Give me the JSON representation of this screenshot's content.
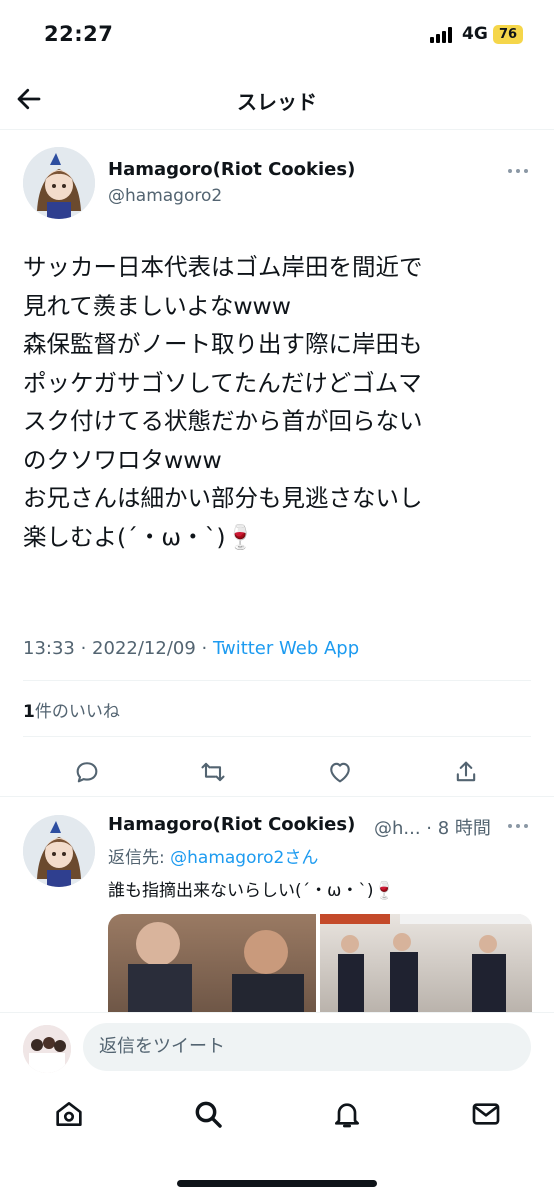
{
  "status_bar": {
    "time": "22:27",
    "network": "4G",
    "battery": "76"
  },
  "header": {
    "title": "スレッド"
  },
  "main_tweet": {
    "author_name": "Hamagoro(Riot Cookies)",
    "author_handle": "@hamagoro2",
    "text_lines": [
      "サッカー日本代表はゴム岸田を間近で",
      "見れて羨ましいよなwww",
      "森保監督がノート取り出す際に岸田も",
      "ポッケガサゴソしてたんだけどゴムマ",
      "スク付けてる状態だから首が回らない",
      "のクソワロタwww",
      "お兄さんは細かい部分も見逃さないし",
      "楽しむよ(´・ω・`)🍷"
    ],
    "timestamp": "13:33 · 2022/12/09 · ",
    "source": "Twitter Web App",
    "likes_count": "1",
    "likes_label": "件のいいね"
  },
  "actions": [
    {
      "name": "reply-icon"
    },
    {
      "name": "retweet-icon"
    },
    {
      "name": "like-icon"
    },
    {
      "name": "share-icon"
    }
  ],
  "reply": {
    "author_name": "Hamagoro(Riot Cookies)",
    "author_handle": "@h... · 8 時間",
    "reply_to_prefix": "返信先: ",
    "reply_to_mention": "@hamagoro2",
    "reply_to_suffix": "さん",
    "text": "誰も指摘出来ないらしい(´・ω・`)🍷"
  },
  "reply_bar": {
    "placeholder": "返信をツイート"
  },
  "tab_bar": [
    {
      "name": "home-icon"
    },
    {
      "name": "search-icon"
    },
    {
      "name": "notifications-icon"
    },
    {
      "name": "messages-icon"
    }
  ],
  "colors": {
    "accent": "#1d9bf0",
    "text": "#0f1419",
    "secondary": "#536471",
    "divider": "#eff3f4",
    "battery": "#f5d64a"
  }
}
